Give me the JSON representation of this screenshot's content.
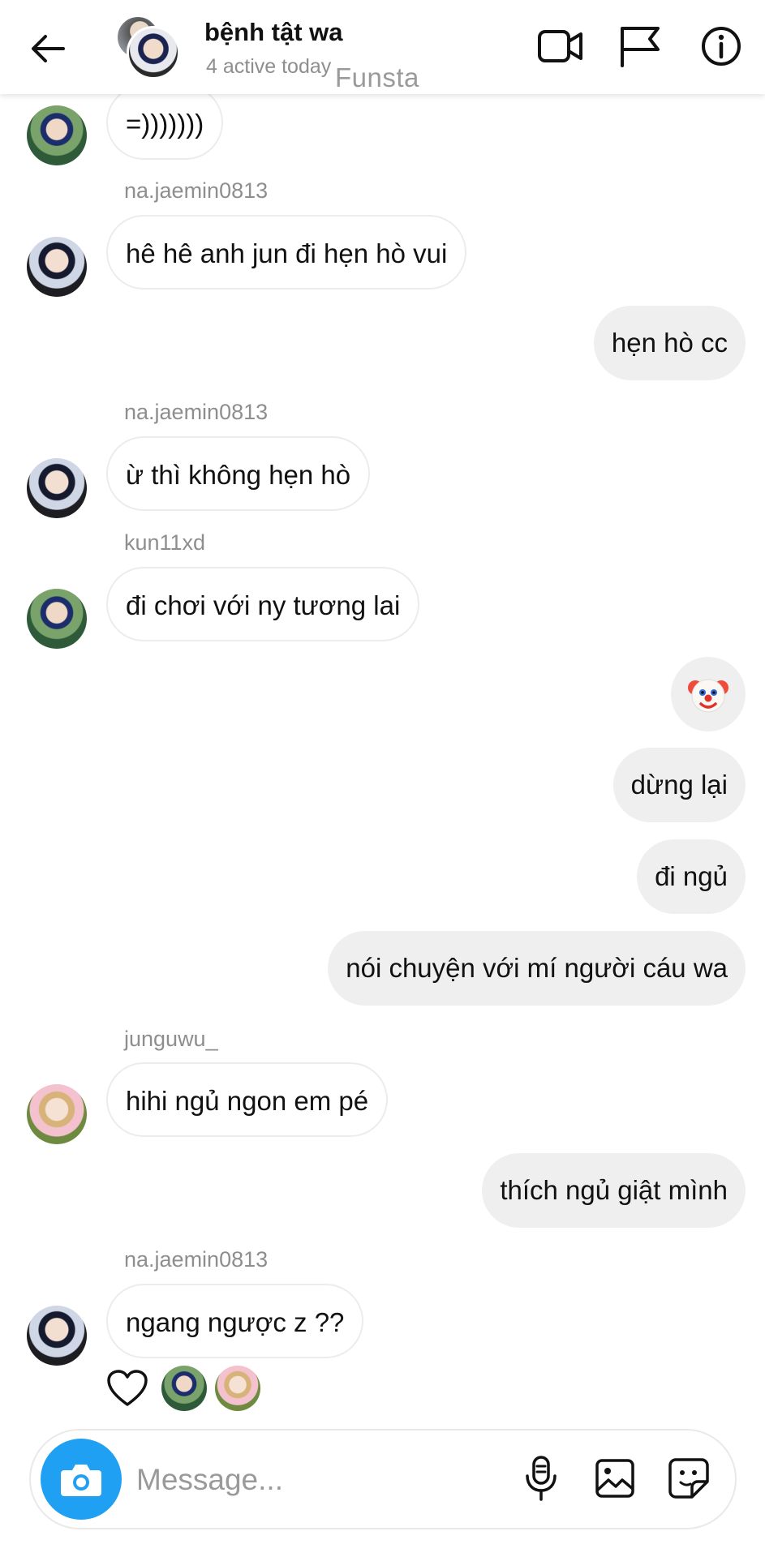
{
  "header": {
    "title": "bệnh tật wa",
    "subtitle": "4 active today",
    "watermark": "Funsta",
    "icons": [
      "arrow-left-icon",
      "video-camera-icon",
      "flag-icon",
      "info-icon"
    ]
  },
  "messages": [
    {
      "direction": "in",
      "sender": "",
      "text": "=)))))))",
      "avatar": "kun11xd"
    },
    {
      "direction": "in",
      "sender": "na.jaemin0813",
      "text": "hê hê anh jun đi hẹn hò vui",
      "avatar": "na.jaemin0813"
    },
    {
      "direction": "out",
      "text": "hẹn hò cc"
    },
    {
      "direction": "in",
      "sender": "na.jaemin0813",
      "text": "ừ thì không hẹn hò",
      "avatar": "na.jaemin0813"
    },
    {
      "direction": "in",
      "sender": "kun11xd",
      "text": "đi chơi với ny tương lai",
      "avatar": "kun11xd"
    },
    {
      "direction": "out",
      "text": "🤡"
    },
    {
      "direction": "out",
      "text": "dừng lại"
    },
    {
      "direction": "out",
      "text": "đi ngủ"
    },
    {
      "direction": "out",
      "text": "nói chuyện với mí người cáu wa"
    },
    {
      "direction": "in",
      "sender": "junguwu_",
      "text": "hihi ngủ ngon em pé",
      "avatar": "junguwu_"
    },
    {
      "direction": "out",
      "text": "thích ngủ giật mình"
    },
    {
      "direction": "in",
      "sender": "na.jaemin0813",
      "text": "ngang ngược z ??",
      "avatar": "na.jaemin0813"
    }
  ],
  "reactions": {
    "icon": "heart-icon",
    "reactor_count": 2
  },
  "composer": {
    "placeholder": "Message...",
    "icons": [
      "camera-icon",
      "microphone-icon",
      "gallery-icon",
      "sticker-icon"
    ],
    "camera_color": "#1fa0f2"
  },
  "colors": {
    "outgoing_bubble": "#efefef",
    "incoming_border": "#ececec",
    "secondary_text": "#8e8e8e"
  }
}
